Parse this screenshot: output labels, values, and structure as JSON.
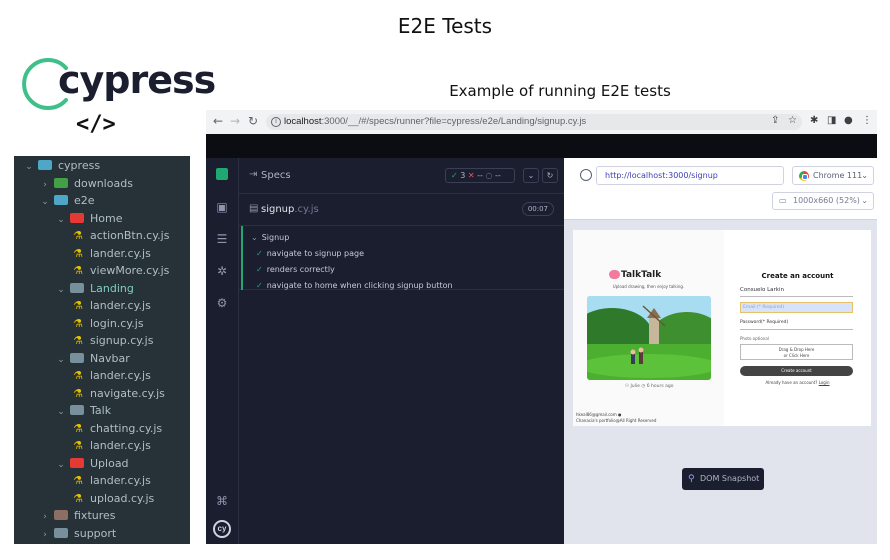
{
  "slide": {
    "title": "E2E Tests",
    "subtitle": "Example of running E2E tests",
    "logo_text": "cypress",
    "code_icon": "</>"
  },
  "tree": [
    {
      "depth": 0,
      "kind": "folder-open",
      "label": "cypress",
      "color": "#4fa7c7"
    },
    {
      "depth": 1,
      "kind": "folder",
      "label": "downloads",
      "color": "#43a047"
    },
    {
      "depth": 1,
      "kind": "folder-open",
      "label": "e2e",
      "color": "#4fa7c7"
    },
    {
      "depth": 2,
      "kind": "folder-open",
      "label": "Home",
      "color": "#e53935"
    },
    {
      "depth": 3,
      "kind": "spec",
      "label": "actionBtn.cy.js"
    },
    {
      "depth": 3,
      "kind": "spec",
      "label": "lander.cy.js"
    },
    {
      "depth": 3,
      "kind": "spec",
      "label": "viewMore.cy.js"
    },
    {
      "depth": 2,
      "kind": "folder-open",
      "label": "Landing",
      "color": "#78909c",
      "highlight": true
    },
    {
      "depth": 3,
      "kind": "spec",
      "label": "lander.cy.js"
    },
    {
      "depth": 3,
      "kind": "spec",
      "label": "login.cy.js"
    },
    {
      "depth": 3,
      "kind": "spec",
      "label": "signup.cy.js"
    },
    {
      "depth": 2,
      "kind": "folder-open",
      "label": "Navbar",
      "color": "#78909c"
    },
    {
      "depth": 3,
      "kind": "spec",
      "label": "lander.cy.js"
    },
    {
      "depth": 3,
      "kind": "spec",
      "label": "navigate.cy.js"
    },
    {
      "depth": 2,
      "kind": "folder-open",
      "label": "Talk",
      "color": "#78909c"
    },
    {
      "depth": 3,
      "kind": "spec",
      "label": "chatting.cy.js"
    },
    {
      "depth": 3,
      "kind": "spec",
      "label": "lander.cy.js"
    },
    {
      "depth": 2,
      "kind": "folder-open",
      "label": "Upload",
      "color": "#e53935"
    },
    {
      "depth": 3,
      "kind": "spec",
      "label": "lander.cy.js"
    },
    {
      "depth": 3,
      "kind": "spec",
      "label": "upload.cy.js"
    },
    {
      "depth": 1,
      "kind": "folder",
      "label": "fixtures",
      "color": "#8d6e63"
    },
    {
      "depth": 1,
      "kind": "folder",
      "label": "support",
      "color": "#78909c"
    }
  ],
  "browser": {
    "url_host": "localhost",
    "url_rest": ":3000/__/#/specs/runner?file=cypress/e2e/Landing/signup.cy.js"
  },
  "runner": {
    "specs_label": "Specs",
    "passed": "3",
    "failed": "--",
    "pending": "--",
    "spec_name": "signup",
    "spec_ext": ".cy.js",
    "duration": "00:07",
    "suite": "Signup",
    "tests": [
      "navigate to signup page",
      "renders correctly",
      "navigate to home when clicking signup button"
    ]
  },
  "aut": {
    "url": "http://localhost:3000/signup",
    "browser": "Chrome 111",
    "viewport": "1000x660 (52%)",
    "snapshot_label": "DOM Snapshot"
  },
  "app": {
    "brand": "TalkTalk",
    "tagline": "Upload drawing, then enjoy talking.",
    "art_author": "Julie",
    "art_time": "6 hours ago",
    "footer_email": "hkeal86@gmail.com",
    "footer_copy": "Chanacia's portfolio@All Right Reserved",
    "form_title": "Create an account",
    "name_value": "Consuelo Larkin",
    "email_placeholder": "Email (* Required)",
    "password_placeholder": "Password(* Required)",
    "photo_label": "Photo optional",
    "dropzone_line1": "Drag & Drop Here",
    "dropzone_line2": "or Click Here",
    "create_button": "Create account",
    "login_prompt": "Already have an account?",
    "login_link": "Login"
  }
}
